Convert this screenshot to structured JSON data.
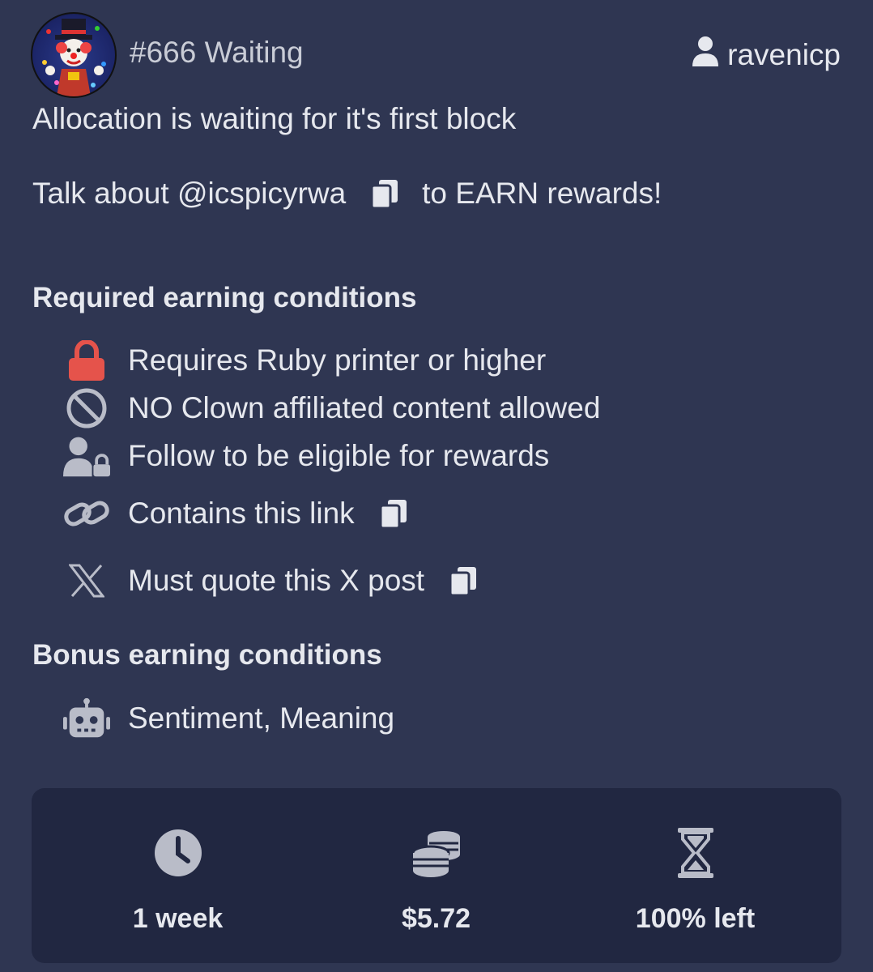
{
  "header": {
    "title": "#666 Waiting",
    "username": "ravenicp"
  },
  "status_message": "Allocation is waiting for it's first block",
  "talk": {
    "prefix": "Talk about @icspicyrwa",
    "suffix": "to EARN rewards!"
  },
  "required": {
    "title": "Required earning conditions",
    "items": [
      {
        "icon": "lock-icon",
        "label": "Requires Ruby printer or higher"
      },
      {
        "icon": "ban-icon",
        "label": "NO Clown affiliated content allowed"
      },
      {
        "icon": "user-lock-icon",
        "label": "Follow to be eligible for rewards"
      },
      {
        "icon": "link-icon",
        "label": "Contains this link"
      },
      {
        "icon": "x-logo-icon",
        "label": "Must quote this X post"
      }
    ]
  },
  "bonus": {
    "title": "Bonus earning conditions",
    "items": [
      {
        "icon": "robot-icon",
        "label": "Sentiment, Meaning"
      }
    ]
  },
  "stats": {
    "duration": "1 week",
    "amount": "$5.72",
    "remaining": "100% left"
  },
  "colors": {
    "background": "#2f3652",
    "panel": "#212741",
    "lock": "#e5534b",
    "icon_gray": "#b9bcc8"
  }
}
